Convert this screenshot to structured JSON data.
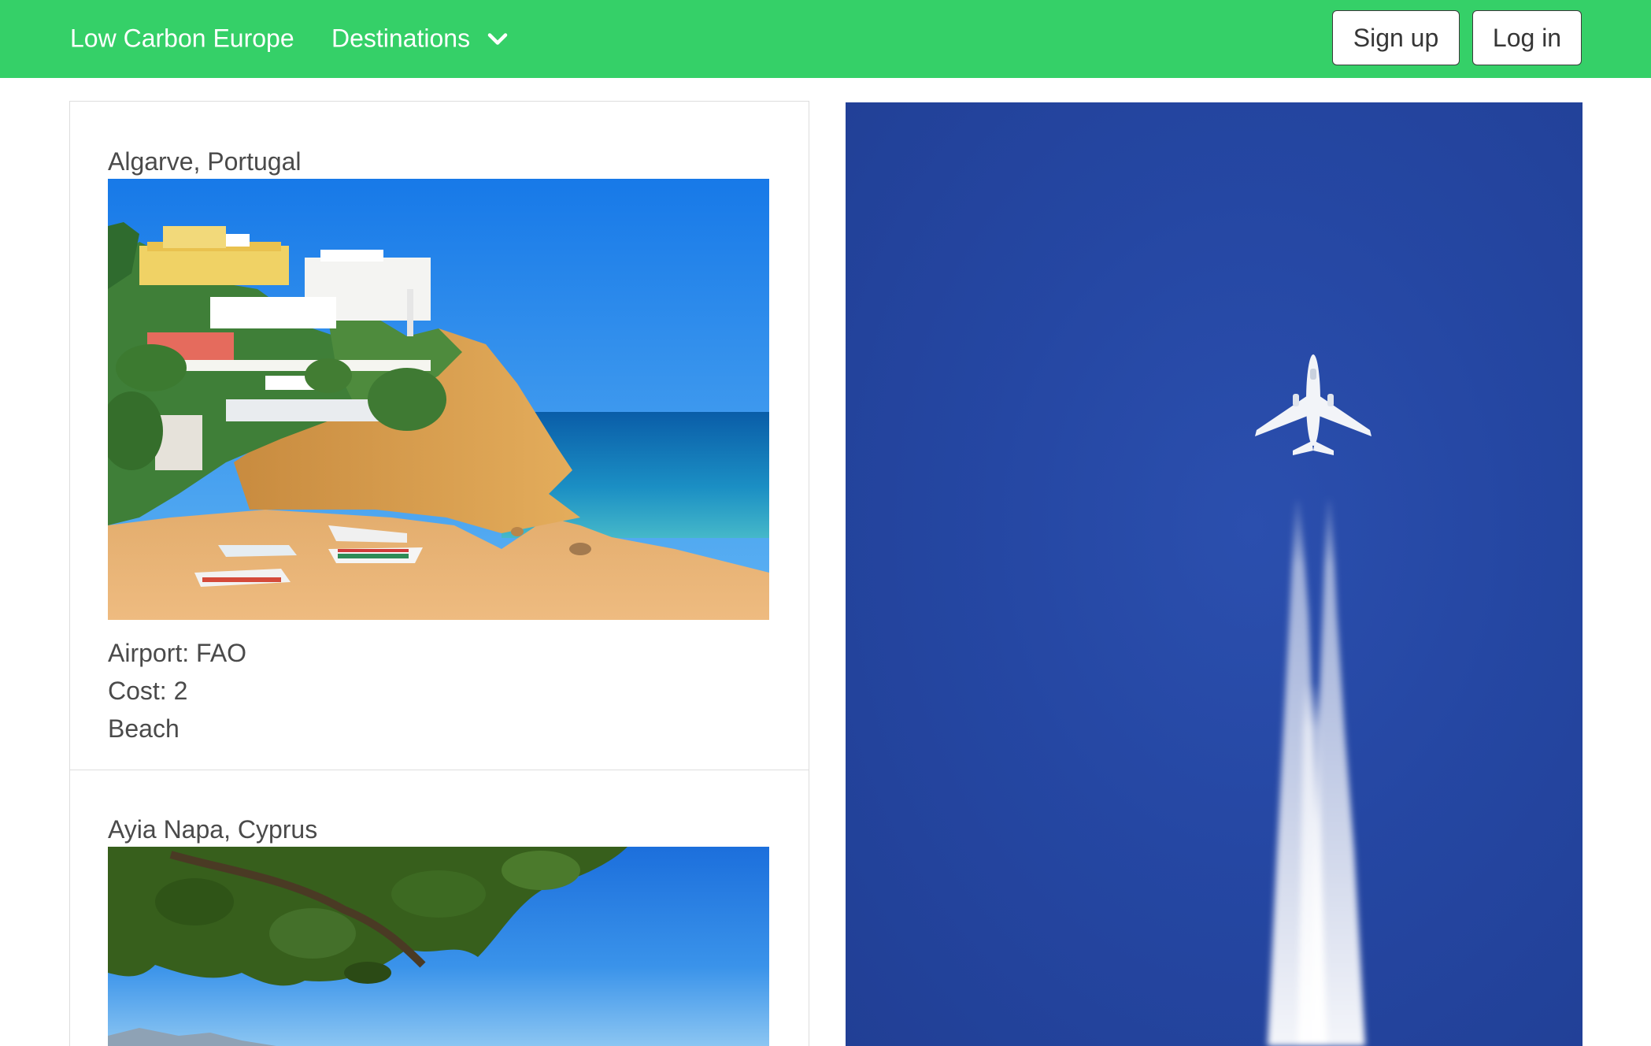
{
  "nav": {
    "brand": "Low Carbon Europe",
    "destinations_label": "Destinations",
    "signup_label": "Sign up",
    "login_label": "Log in"
  },
  "destinations": [
    {
      "title": "Algarve, Portugal",
      "airport": "Airport: FAO",
      "cost": "Cost: 2",
      "category": "Beach"
    },
    {
      "title": "Ayia Napa, Cyprus"
    }
  ],
  "colors": {
    "navbar_green": "#35d068",
    "hero_blue": "#2547a3"
  }
}
